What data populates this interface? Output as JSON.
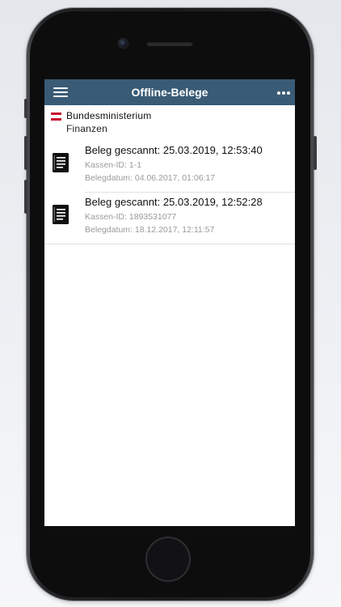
{
  "header": {
    "title": "Offline-Belege"
  },
  "branding": {
    "line1": "Bundesministerium",
    "line2": "Finanzen",
    "flag_colors": [
      "#c8102e",
      "#ffffff",
      "#c8102e"
    ]
  },
  "receipts": [
    {
      "title": "Beleg gescannt: 25.03.2019, 12:53:40",
      "kassen_id": "Kassen-ID: 1-1",
      "belegdatum": "Belegdatum: 04.06.2017, 01:06:17",
      "icon": "receipt-document-icon"
    },
    {
      "title": "Beleg gescannt: 25.03.2019, 12:52:28",
      "kassen_id": "Kassen-ID: 1893531077",
      "belegdatum": "Belegdatum: 18.12.2017, 12:11:57",
      "icon": "receipt-document-icon"
    }
  ],
  "colors": {
    "navbar": "#3a5b75",
    "secondary_text": "#9a9a9a"
  }
}
